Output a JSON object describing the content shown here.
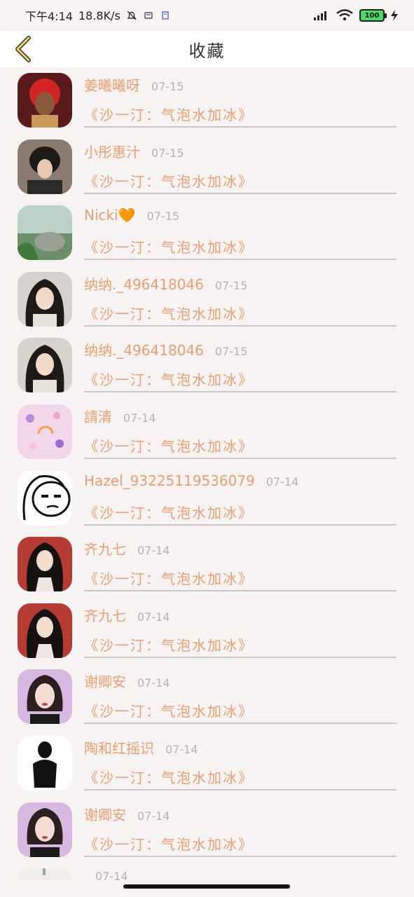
{
  "status_bar": {
    "time": "下午4:14",
    "speed": "18.8K/s",
    "battery": "100"
  },
  "header": {
    "title": "收藏"
  },
  "items": [
    {
      "name": "姜曦曦呀",
      "date": "07-15",
      "song": "《沙一汀：气泡水加冰》",
      "avatar_icon": "avatar-red-hair"
    },
    {
      "name": "小彤惠汁",
      "date": "07-15",
      "song": "《沙一汀：气泡水加冰》",
      "avatar_icon": "avatar-dark-hair"
    },
    {
      "name": "Nicki🧡",
      "date": "07-15",
      "song": "《沙一汀：气泡水加冰》",
      "avatar_icon": "avatar-green-nature"
    },
    {
      "name": "纳纳._496418046",
      "date": "07-15",
      "song": "《沙一汀：气泡水加冰》",
      "avatar_icon": "avatar-girl-long-hair"
    },
    {
      "name": "纳纳._496418046",
      "date": "07-15",
      "song": "《沙一汀：气泡水加冰》",
      "avatar_icon": "avatar-girl-long-hair"
    },
    {
      "name": "請清",
      "date": "07-14",
      "song": "《沙一汀：气泡水加冰》",
      "avatar_icon": "avatar-pink-pattern"
    },
    {
      "name": "Hazel_93225119536079",
      "date": "07-14",
      "song": "《沙一汀：气泡水加冰》",
      "avatar_icon": "avatar-cartoon-face"
    },
    {
      "name": "齐九七",
      "date": "07-14",
      "song": "《沙一汀：气泡水加冰》",
      "avatar_icon": "avatar-girl-red"
    },
    {
      "name": "齐九七",
      "date": "07-14",
      "song": "《沙一汀：气泡水加冰》",
      "avatar_icon": "avatar-girl-red"
    },
    {
      "name": "谢卿安",
      "date": "07-14",
      "song": "《沙一汀：气泡水加冰》",
      "avatar_icon": "avatar-woman-purple"
    },
    {
      "name": "陶和红摇识",
      "date": "07-14",
      "song": "《沙一汀：气泡水加冰》",
      "avatar_icon": "avatar-black-figure"
    },
    {
      "name": "谢卿安",
      "date": "07-14",
      "song": "《沙一汀：气泡水加冰》",
      "avatar_icon": "avatar-woman-purple"
    },
    {
      "name": "",
      "date": "07-14",
      "song": "",
      "avatar_icon": "avatar-partial"
    }
  ],
  "colors": {
    "accent": "#e99f71",
    "muted": "#b7b2b2",
    "background": "#f7f3f3"
  }
}
